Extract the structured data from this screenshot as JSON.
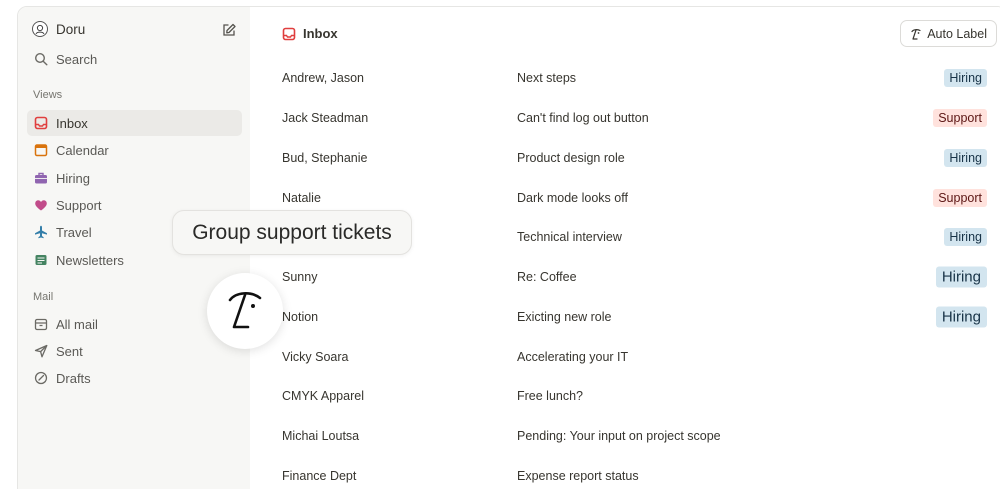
{
  "sidebar": {
    "account_name": "Doru",
    "search_label": "Search",
    "views_heading": "Views",
    "views": [
      {
        "label": "Inbox",
        "icon": "inbox-icon",
        "color": "#e03e3e",
        "active": true
      },
      {
        "label": "Calendar",
        "icon": "calendar-icon",
        "color": "#d9730d"
      },
      {
        "label": "Hiring",
        "icon": "briefcase-icon",
        "color": "#9065b0"
      },
      {
        "label": "Support",
        "icon": "heart-icon",
        "color": "#c14c8a"
      },
      {
        "label": "Travel",
        "icon": "airplane-icon",
        "color": "#337ea9"
      },
      {
        "label": "Newsletters",
        "icon": "newspaper-icon",
        "color": "#448361"
      }
    ],
    "mail_heading": "Mail",
    "mail": [
      {
        "label": "All mail",
        "icon": "archive-icon"
      },
      {
        "label": "Sent",
        "icon": "send-icon"
      },
      {
        "label": "Drafts",
        "icon": "drafts-icon"
      }
    ]
  },
  "main": {
    "title": "Inbox",
    "auto_label_button": "Auto Label",
    "rows": [
      {
        "sender": "Andrew, Jason",
        "subject": "Next steps",
        "tag": "Hiring"
      },
      {
        "sender": "Jack Steadman",
        "subject": "Can't find log out button",
        "tag": "Support"
      },
      {
        "sender": "Bud, Stephanie",
        "subject": "Product design role",
        "tag": "Hiring"
      },
      {
        "sender": "Natalie",
        "subject": "Dark mode looks off",
        "tag": "Support"
      },
      {
        "sender": "",
        "subject": "Technical interview",
        "tag": "Hiring"
      },
      {
        "sender": "Sunny",
        "subject": "Re: Coffee",
        "tag": "Hiring"
      },
      {
        "sender": "Notion",
        "subject": "Exicting new role",
        "tag": "Hiring"
      },
      {
        "sender": "Vicky Soara",
        "subject": "Accelerating your IT",
        "tag": ""
      },
      {
        "sender": "CMYK Apparel",
        "subject": "Free lunch?",
        "tag": ""
      },
      {
        "sender": "Michai Loutsa",
        "subject": "Pending: Your input on project scope",
        "tag": ""
      },
      {
        "sender": "Finance Dept",
        "subject": "Expense report status",
        "tag": ""
      }
    ]
  },
  "overlay": {
    "tooltip_text": "Group support tickets",
    "logo_icon": "notion-mail-logo-icon"
  },
  "colors": {
    "hiring_bg": "#d3e5ef",
    "support_bg": "#ffe2dd",
    "sidebar_bg": "#f7f7f5"
  }
}
